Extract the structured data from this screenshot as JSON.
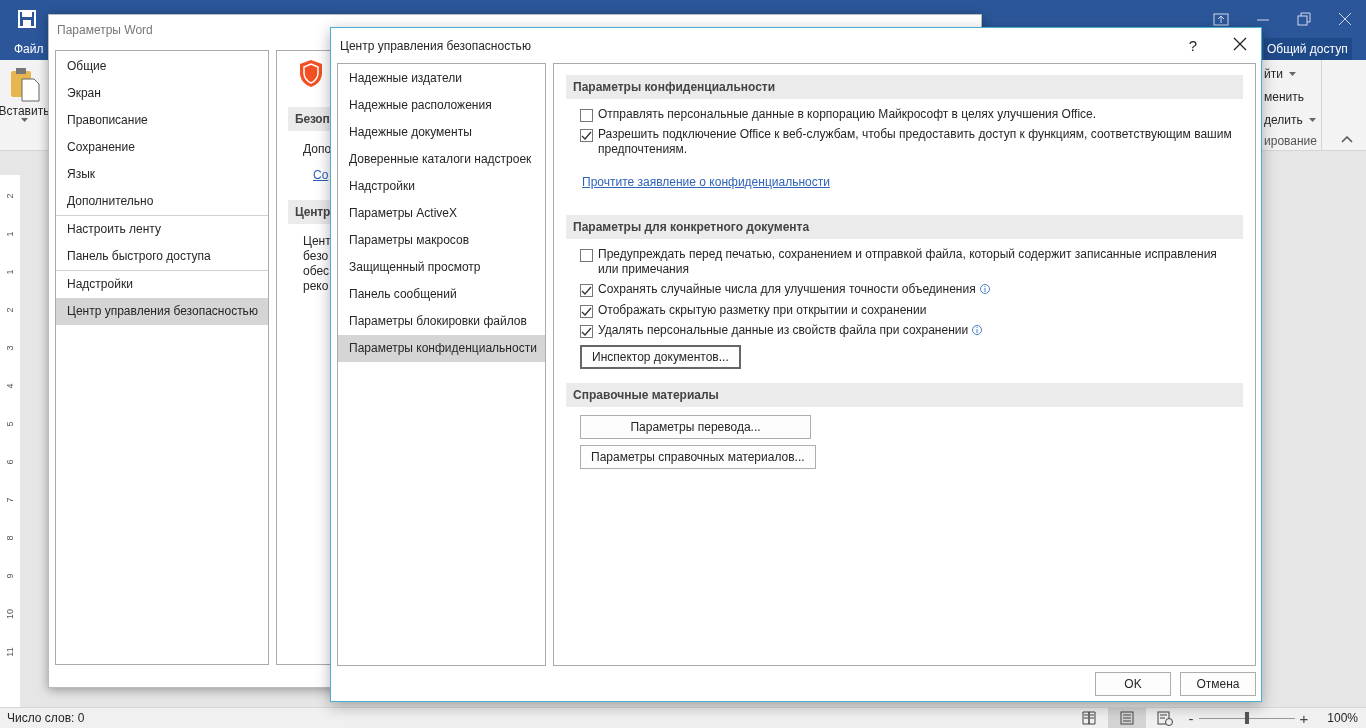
{
  "word": {
    "tab_file": "Файл",
    "share": "Общий доступ",
    "paste": "Вставить",
    "ribbon_fragments": [
      {
        "label": "йти",
        "caret": true
      },
      {
        "label": "менить",
        "caret": false
      },
      {
        "label": "делить",
        "caret": true
      }
    ],
    "group_fragment": "ирование",
    "ruler": [
      "2",
      "1",
      "1",
      "2",
      "3",
      "4",
      "5",
      "6",
      "7",
      "8",
      "9",
      "10",
      "11"
    ],
    "status_bar": {
      "word_count": "Число слов: 0",
      "views": [
        {
          "kind": "read",
          "selected": false
        },
        {
          "kind": "print",
          "selected": true
        },
        {
          "kind": "web",
          "selected": false
        }
      ],
      "zoom_out": "-",
      "zoom_in": "+",
      "zoom_slider": {
        "level": 0.5
      },
      "zoom": "100%"
    }
  },
  "options_dialog": {
    "title": "Параметры Word",
    "nav_groups": [
      {
        "items": [
          {
            "label": "Общие",
            "selected": false
          },
          {
            "label": "Экран",
            "selected": false
          },
          {
            "label": "Правописание",
            "selected": false
          },
          {
            "label": "Сохранение",
            "selected": false
          },
          {
            "label": "Язык",
            "selected": false
          },
          {
            "label": "Дополнительно",
            "selected": false
          }
        ]
      },
      {
        "items": [
          {
            "label": "Настроить ленту",
            "selected": false
          },
          {
            "label": "Панель быстрого доступа",
            "selected": false
          }
        ]
      },
      {
        "items": [
          {
            "label": "Надстройки",
            "selected": false
          },
          {
            "label": "Центр управления безопасностью",
            "selected": true
          }
        ]
      }
    ],
    "panel": {
      "section_1": "Безоп",
      "line_1": "Допо",
      "link": "Со",
      "section_2": "Центр",
      "paragraph_lines": [
        "Цент",
        "безо",
        "обес",
        "реко"
      ]
    }
  },
  "trust_dialog": {
    "title": "Центр управления безопасностью",
    "help": "?",
    "nav": [
      {
        "label": "Надежные издатели",
        "selected": false
      },
      {
        "label": "Надежные расположения",
        "selected": false
      },
      {
        "label": "Надежные документы",
        "selected": false
      },
      {
        "label": "Доверенные каталоги надстроек",
        "selected": false
      },
      {
        "label": "Надстройки",
        "selected": false
      },
      {
        "label": "Параметры ActiveX",
        "selected": false
      },
      {
        "label": "Параметры макросов",
        "selected": false
      },
      {
        "label": "Защищенный просмотр",
        "selected": false
      },
      {
        "label": "Панель сообщений",
        "selected": false
      },
      {
        "label": "Параметры блокировки файлов",
        "selected": false
      },
      {
        "label": "Параметры конфиденциальности",
        "selected": true
      }
    ],
    "sections": [
      {
        "title": "Параметры конфиденциальности",
        "items": [
          {
            "kind": "checkbox",
            "label": "Отправлять персональные данные в корпорацию Майкрософт в целях улучшения Office.",
            "checked": false,
            "info": false
          },
          {
            "kind": "checkbox",
            "label": "Разрешить подключение Office к веб-службам, чтобы предоставить доступ к функциям, соответствующим вашим предпочтениям.",
            "checked": true,
            "info": false
          },
          {
            "kind": "link",
            "label": "Прочтите заявление о конфиденциальности"
          }
        ]
      },
      {
        "title": "Параметры для конкретного документа",
        "items": [
          {
            "kind": "checkbox",
            "label": "Предупреждать перед печатью, сохранением и отправкой файла, который содержит записанные исправления или примечания",
            "checked": false,
            "info": false
          },
          {
            "kind": "checkbox",
            "label": "Сохранять случайные числа для улучшения точности объединения",
            "checked": true,
            "info": true
          },
          {
            "kind": "checkbox",
            "label": "Отображать скрытую разметку при открытии и сохранении",
            "checked": true,
            "info": false
          },
          {
            "kind": "checkbox",
            "label": "Удалять персональные данные из свойств файла при сохранении",
            "checked": true,
            "info": true
          },
          {
            "kind": "button",
            "label": "Инспектор документов..."
          }
        ]
      },
      {
        "title": "Справочные материалы",
        "items": [
          {
            "kind": "button",
            "label": "Параметры перевода..."
          },
          {
            "kind": "button",
            "label": "Параметры справочных материалов..."
          }
        ]
      }
    ],
    "buttons": [
      "OK",
      "Отмена"
    ]
  }
}
